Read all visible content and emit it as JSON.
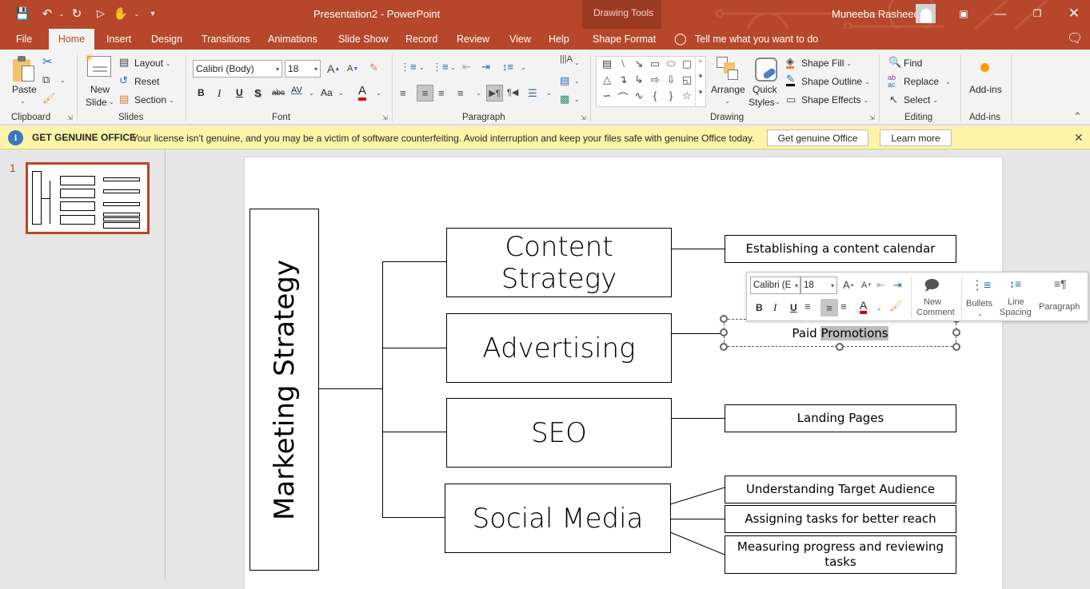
{
  "titlebar": {
    "document_title": "Presentation2  -  PowerPoint",
    "context_tab_group": "Drawing Tools",
    "user_name": "Muneeba Rasheed",
    "quick_access": [
      "save-icon",
      "undo-icon",
      "redo-icon",
      "present-from-beginning-icon",
      "touch-mode-icon",
      "customize-qat-icon"
    ],
    "window_controls": [
      "ribbon-display-options-icon",
      "minimize-icon",
      "restore-icon",
      "close-icon"
    ]
  },
  "tabs": [
    "File",
    "Home",
    "Insert",
    "Design",
    "Transitions",
    "Animations",
    "Slide Show",
    "Record",
    "Review",
    "View",
    "Help",
    "Shape Format"
  ],
  "active_tab": "Home",
  "tell_me": "Tell me what you want to do",
  "ribbon": {
    "clipboard": {
      "label": "Clipboard",
      "paste": "Paste"
    },
    "slides": {
      "label": "Slides",
      "new_slide_1": "New",
      "new_slide_2": "Slide",
      "layout": "Layout",
      "reset": "Reset",
      "section": "Section"
    },
    "font": {
      "label": "Font",
      "font_name": "Calibri (Body)",
      "font_size": "18",
      "bold": "B",
      "italic": "I",
      "underline": "U",
      "shadow": "S",
      "strike": "abc",
      "spacing": "AV",
      "case": "Aa",
      "color": "A"
    },
    "paragraph": {
      "label": "Paragraph"
    },
    "drawing": {
      "label": "Drawing",
      "arrange": "Arrange",
      "quick_styles_1": "Quick",
      "quick_styles_2": "Styles",
      "shape_fill": "Shape Fill",
      "shape_outline": "Shape Outline",
      "shape_effects": "Shape Effects"
    },
    "editing": {
      "label": "Editing",
      "find": "Find",
      "replace": "Replace",
      "select": "Select"
    },
    "addins": {
      "label": "Add-ins",
      "button": "Add-ins"
    }
  },
  "infobar": {
    "title": "GET GENUINE OFFICE",
    "message": "Your license isn't genuine, and you may be a victim of software counterfeiting. Avoid interruption and keep your files safe with genuine Office today.",
    "button_primary": "Get genuine Office",
    "button_secondary": "Learn more"
  },
  "thumbnails": [
    {
      "number": "1",
      "selected": true
    }
  ],
  "slide": {
    "root": "Marketing Strategy",
    "branches": [
      {
        "label": "Content Strategy",
        "children": [
          "Establishing a content calendar"
        ]
      },
      {
        "label": "Advertising",
        "children": [
          "Paid Promotions"
        ]
      },
      {
        "label": "SEO",
        "children": [
          "Landing Pages"
        ]
      },
      {
        "label": "Social Media",
        "children": [
          "Understanding Target Audience",
          "Assigning tasks for better reach",
          "Measuring progress and reviewing tasks"
        ]
      }
    ],
    "selected_text_prefix": "Paid ",
    "selected_text_highlight": "Promotions"
  },
  "mini_toolbar": {
    "font_name": "Calibri (E",
    "font_size": "18",
    "new_comment_1": "New",
    "new_comment_2": "Comment",
    "bullets": "Bullets",
    "line_spacing_1": "Line",
    "line_spacing_2": "Spacing",
    "paragraph": "Paragraph"
  },
  "colors": {
    "accent": "#b7472a",
    "infobar": "#fdf4a8",
    "font_color": "#e00000",
    "shape_fill": "#ed7d31"
  }
}
